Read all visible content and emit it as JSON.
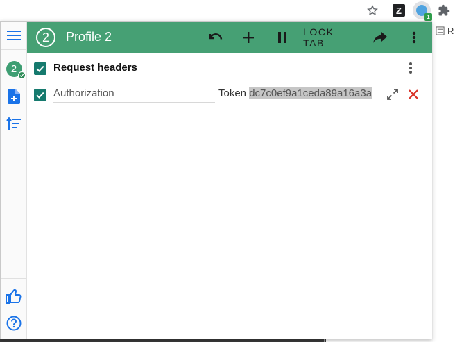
{
  "browser": {
    "extension_z_label": "Z",
    "active_extension_badge": "1",
    "background_page_text": "R"
  },
  "profile": {
    "number": "2",
    "title": "Profile 2"
  },
  "header": {
    "lock_tab_label": "LOCK TAB"
  },
  "section": {
    "title": "Request headers"
  },
  "headers": [
    {
      "name": "Authorization",
      "value_prefix": "Token ",
      "value_selected": "dc7c0ef9a1ceda89a16a3a"
    }
  ],
  "colors": {
    "header_green": "#46a074",
    "checkbox_teal": "#167a6e",
    "sidebar_blue": "#1a73e8",
    "delete_red": "#d93025"
  },
  "icons": {
    "sidebar": [
      "menu-icon",
      "profile-icon",
      "add-file-icon",
      "sort-icon",
      "thumbs-up-icon",
      "help-icon"
    ],
    "header": [
      "undo-icon",
      "add-icon",
      "pause-icon",
      "share-icon",
      "more-vert-icon"
    ]
  }
}
